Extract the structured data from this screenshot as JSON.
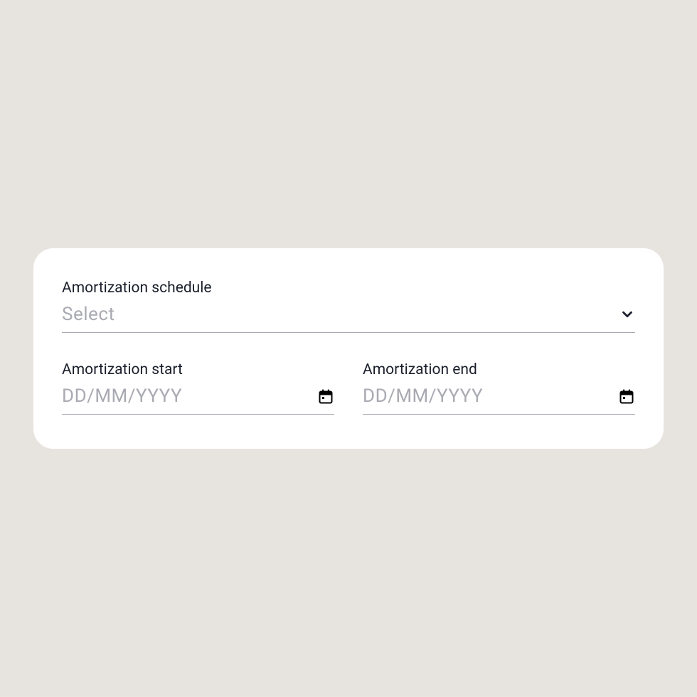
{
  "schedule": {
    "label": "Amortization schedule",
    "placeholder": "Select"
  },
  "start": {
    "label": "Amortization start",
    "placeholder": "DD/MM/YYYY"
  },
  "end": {
    "label": "Amortization end",
    "placeholder": "DD/MM/YYYY"
  }
}
